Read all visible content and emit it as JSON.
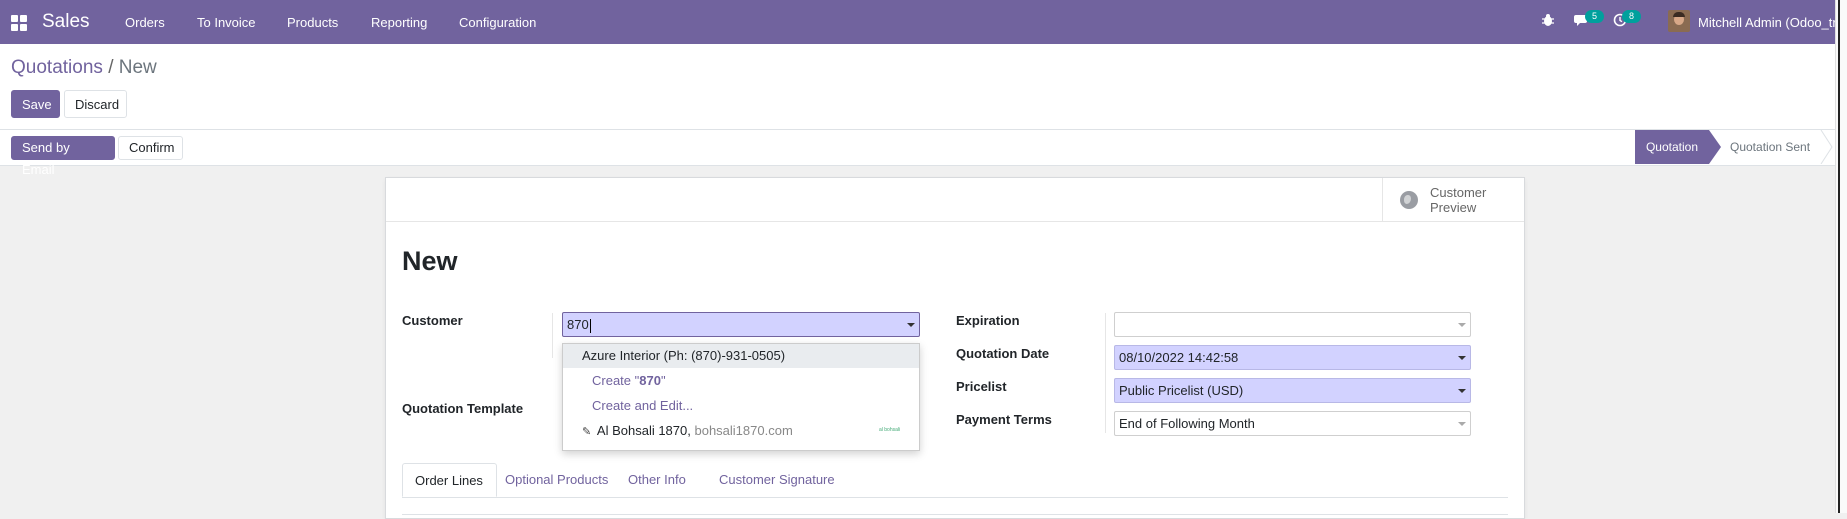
{
  "navbar": {
    "app_name": "Sales",
    "menu": [
      "Orders",
      "To Invoice",
      "Products",
      "Reporting",
      "Configuration"
    ],
    "messages_count": "5",
    "activities_count": "8",
    "user_name": "Mitchell Admin (Odoo_tr",
    "icons": [
      "apps-grid-icon",
      "bug-icon",
      "chat-icon",
      "clock-icon"
    ]
  },
  "breadcrumb": {
    "parent": "Quotations",
    "separator": "/",
    "current": "New"
  },
  "actions": {
    "save": "Save",
    "discard": "Discard"
  },
  "statusbar": {
    "send_email": "Send by Email",
    "confirm": "Confirm",
    "stages": [
      "Quotation",
      "Quotation Sent"
    ],
    "active_stage": "Quotation"
  },
  "sheet": {
    "preview_label": "Customer Preview",
    "title": "New",
    "labels": {
      "customer": "Customer",
      "quotation_template": "Quotation Template",
      "expiration": "Expiration",
      "quotation_date": "Quotation Date",
      "pricelist": "Pricelist",
      "payment_terms": "Payment Terms"
    },
    "values": {
      "customer": "870",
      "expiration": "",
      "quotation_date": "08/10/2022 14:42:58",
      "pricelist": "Public Pricelist (USD)",
      "payment_terms": "End of Following Month"
    }
  },
  "autocomplete": {
    "result": "Azure Interior (Ph: (870)-931-0505)",
    "create_prefix": "Create \"",
    "create_term": "870",
    "create_suffix": "\"",
    "create_edit": "Create and Edit...",
    "enrich_name": "Al Bohsali 1870,",
    "enrich_domain": "bohsali1870.com",
    "enrich_logo_text": "al bohsali"
  },
  "tabs": [
    "Order Lines",
    "Optional Products",
    "Other Info",
    "Customer Signature"
  ],
  "colors": {
    "brand": "#71639e",
    "badge": "#00a09d",
    "required_field": "#d2d2ff"
  }
}
